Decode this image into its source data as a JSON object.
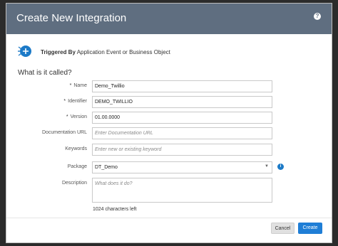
{
  "dialog": {
    "title": "Create New Integration",
    "help_label": "?"
  },
  "trigger": {
    "heading": "Triggered By",
    "description": "Application Event or Business Object"
  },
  "section_title": "What is it called?",
  "fields": {
    "name": {
      "label": "Name",
      "required": "*",
      "value": "Demo_Twillio"
    },
    "identifier": {
      "label": "Identifier",
      "required": "*",
      "value": "DEMO_TWILLIO"
    },
    "version": {
      "label": "Version",
      "required": "*",
      "value": "01.00.0000"
    },
    "documentation_url": {
      "label": "Documentation URL",
      "placeholder": "Enter Documentation URL"
    },
    "keywords": {
      "label": "Keywords",
      "placeholder": "Enter new or existing keyword"
    },
    "package": {
      "label": "Package",
      "value": "DT_Demo"
    },
    "description": {
      "label": "Description",
      "placeholder": "What does it do?"
    }
  },
  "info_label": "i",
  "char_count": "1024 characters left",
  "buttons": {
    "cancel": "Cancel",
    "create": "Create"
  },
  "colors": {
    "header": "#5f6e80",
    "primary": "#1f7ed6",
    "icon_blue": "#1c7ac7"
  },
  "icons": {
    "help": "help-circle-icon",
    "trigger": "app-event-trigger-icon",
    "dropdown": "caret-down-icon",
    "info": "info-circle-icon"
  }
}
